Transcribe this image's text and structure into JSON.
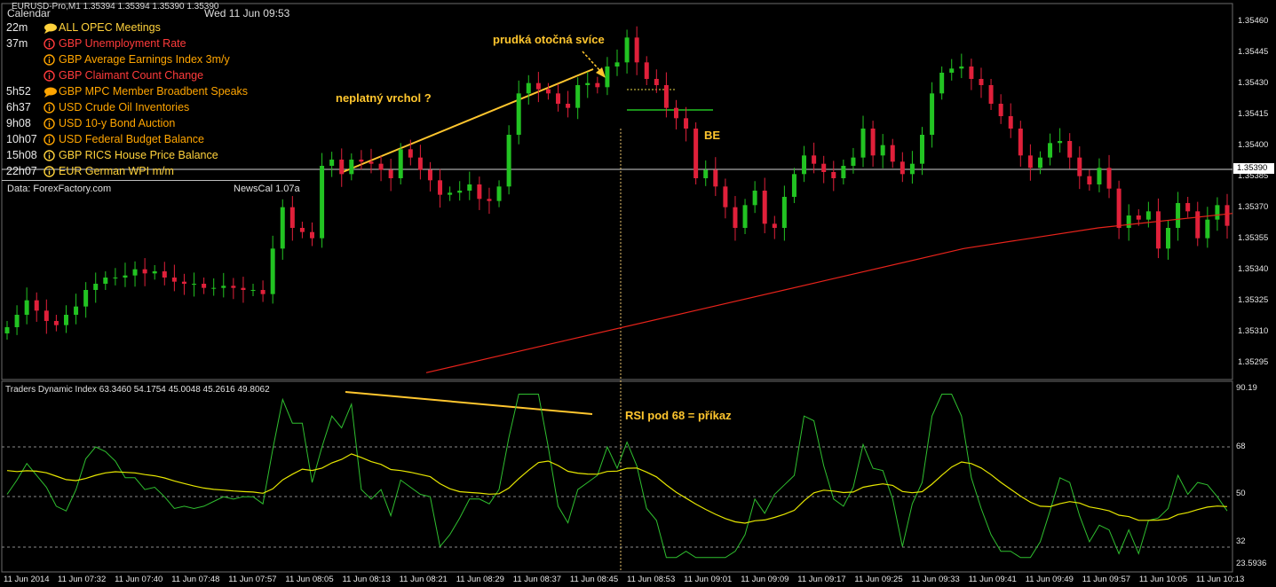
{
  "symbol_header": "EURUSD-Pro,M1  1.35394 1.35394 1.35390 1.35390",
  "calendar": {
    "title": "Calendar",
    "date": "Wed 11 Jun 09:53",
    "events": [
      {
        "time": "22m",
        "icon": "speech-icon",
        "text": "ALL  OPEC Meetings",
        "color": "yellow"
      },
      {
        "time": "37m",
        "icon": "info-icon",
        "text": "GBP Unemployment Rate",
        "color": "red"
      },
      {
        "time": "",
        "icon": "info-icon",
        "text": "GBP Average Earnings Index 3m/y",
        "color": "orange"
      },
      {
        "time": "",
        "icon": "info-icon",
        "text": "GBP Claimant Count Change",
        "color": "red"
      },
      {
        "time": "5h52",
        "icon": "speech-icon",
        "text": "GBP MPC Member Broadbent Speaks",
        "color": "orange"
      },
      {
        "time": "6h37",
        "icon": "info-icon",
        "text": "USD Crude Oil Inventories",
        "color": "orange"
      },
      {
        "time": "9h08",
        "icon": "info-icon",
        "text": "USD 10-y Bond Auction",
        "color": "orange"
      },
      {
        "time": "10h07",
        "icon": "info-icon",
        "text": "USD Federal Budget Balance",
        "color": "orange"
      },
      {
        "time": "15h08",
        "icon": "info-icon",
        "text": "GBP RICS House Price Balance",
        "color": "yellow"
      },
      {
        "time": "22h07",
        "icon": "info-icon",
        "text": "EUR German WPI m/m",
        "color": "yellow"
      }
    ],
    "source": "Data: ForexFactory.com",
    "version": "NewsCal 1.07a"
  },
  "annotations": {
    "invalid_top": "neplatný vrchol ?",
    "reversal_candle": "prudká otočná svíce",
    "breakeven": "BE",
    "rsi_signal": "RSI pod 68 = příkaz"
  },
  "chart_data": {
    "type": "candlestick",
    "price_axis_ticks": [
      "1.35460",
      "1.35445",
      "1.35430",
      "1.35415",
      "1.35400",
      "1.35385",
      "1.35370",
      "1.35355",
      "1.35340",
      "1.35325",
      "1.35310",
      "1.35295"
    ],
    "current_price": "1.35390",
    "time_axis_ticks": [
      "11 Jun 2014",
      "11 Jun 07:32",
      "11 Jun 07:40",
      "11 Jun 07:48",
      "11 Jun 07:57",
      "11 Jun 08:05",
      "11 Jun 08:13",
      "11 Jun 08:21",
      "11 Jun 08:29",
      "11 Jun 08:37",
      "11 Jun 08:45",
      "11 Jun 08:53",
      "11 Jun 09:01",
      "11 Jun 09:09",
      "11 Jun 09:17",
      "11 Jun 09:25",
      "11 Jun 09:33",
      "11 Jun 09:41",
      "11 Jun 09:49",
      "11 Jun 09:57",
      "11 Jun 10:05",
      "11 Jun 10:13"
    ],
    "candle_close_path": [
      1.35312,
      1.35318,
      1.35325,
      1.3532,
      1.35315,
      1.35313,
      1.35318,
      1.35322,
      1.3533,
      1.35333,
      1.35336,
      1.35336,
      1.35337,
      1.3534,
      1.35338,
      1.35339,
      1.35336,
      1.35334,
      1.35333,
      1.35333,
      1.35331,
      1.35331,
      1.35332,
      1.35331,
      1.3533,
      1.3533,
      1.35328,
      1.3535,
      1.3537,
      1.3536,
      1.35358,
      1.35355,
      1.3539,
      1.35393,
      1.35386,
      1.35393,
      1.35392,
      1.35391,
      1.35388,
      1.35384,
      1.35398,
      1.35394,
      1.35388,
      1.35383,
      1.35376,
      1.35377,
      1.35378,
      1.35381,
      1.35374,
      1.35373,
      1.3538,
      1.35405,
      1.35425,
      1.3543,
      1.35427,
      1.35425,
      1.3542,
      1.35418,
      1.35429,
      1.3543,
      1.35428,
      1.35438,
      1.3544,
      1.35452,
      1.3544,
      1.35432,
      1.35429,
      1.35418,
      1.35413,
      1.35408,
      1.35384,
      1.35388,
      1.3538,
      1.3537,
      1.3536,
      1.35371,
      1.35378,
      1.35362,
      1.3536,
      1.35375,
      1.35386,
      1.35395,
      1.35391,
      1.35387,
      1.35384,
      1.3539,
      1.35394,
      1.35408,
      1.35395,
      1.354,
      1.35392,
      1.35386,
      1.35391,
      1.35405,
      1.35425,
      1.35435,
      1.35437,
      1.35438,
      1.35432,
      1.35429,
      1.3542,
      1.35414,
      1.35408,
      1.35395,
      1.35389,
      1.35394,
      1.35401,
      1.35402,
      1.35394,
      1.35385,
      1.35381,
      1.35389,
      1.35379,
      1.3536,
      1.35366,
      1.35364,
      1.35368,
      1.3535,
      1.3536,
      1.35372,
      1.35368,
      1.35355,
      1.35364,
      1.35371,
      1.35361
    ],
    "moving_average": {
      "color": "#e8231b",
      "values": [
        1.3529,
        1.35305,
        1.3532,
        1.35335,
        1.3535,
        1.3536,
        1.35367
      ]
    },
    "indicator": {
      "name": "Traders Dynamic Index 63.3460 54.1754 45.0048 45.2616 49.8062",
      "axis_ticks": [
        "90.19",
        "68",
        "50",
        "32",
        "23.5936"
      ],
      "levels": [
        68,
        50,
        32
      ],
      "rsi_color": "#2fbf2f",
      "signal_color": "#e6e600"
    },
    "colors": {
      "bull": "#22c322",
      "bear": "#e0203a",
      "grid": "#6e6e6e",
      "trend_line": "#ffc62e"
    }
  }
}
